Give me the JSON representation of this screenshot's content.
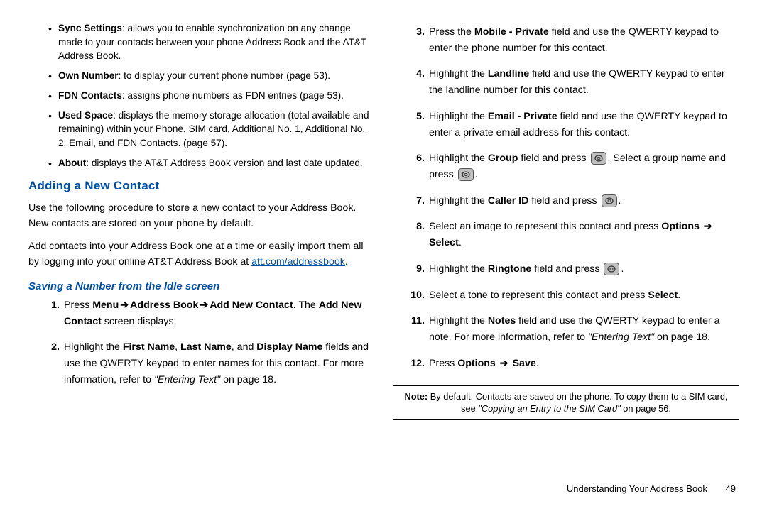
{
  "leftColumn": {
    "bullets": [
      {
        "term": "Sync Settings",
        "desc": ": allows you to enable synchronization on any change made to your contacts between your phone Address Book and the AT&T Address Book."
      },
      {
        "term": "Own Number",
        "desc": ": to display your current phone number (page 53)."
      },
      {
        "term": "FDN Contacts",
        "desc": ": assigns phone numbers as FDN entries (page 53)."
      },
      {
        "term": "Used Space",
        "desc": ": displays the memory storage allocation (total available and remaining) within your Phone, SIM card, Additional No. 1, Additional No. 2, Email, and FDN Contacts. (page 57)."
      },
      {
        "term": "About",
        "desc": ": displays the AT&T Address Book version and last date updated."
      }
    ],
    "heading1": "Adding a New Contact",
    "para1": "Use the following procedure to store a new contact to your Address Book. New contacts are stored on your phone by default.",
    "para2a": "Add contacts into your Address Book one at a time or easily import them all by logging into your online AT&T Address Book at ",
    "link": "att.com/addressbook",
    "para2b": ".",
    "heading2": "Saving a Number from the Idle screen",
    "step1": {
      "a": "Press ",
      "b1": "Menu",
      "b2": "Address Book",
      "b3": "Add New Contact",
      "c": ". The ",
      "d": "Add New Contact",
      "e": " screen displays."
    },
    "step2": {
      "a": "Highlight the ",
      "b1": "First Name",
      "c1": ", ",
      "b2": "Last Name",
      "c2": ", and ",
      "b3": "Display Name",
      "c3": " fields and use the QWERTY keypad to enter names for this contact. For more information, refer to ",
      "ref": "\"Entering Text\"",
      "c4": " on page 18."
    }
  },
  "rightColumn": {
    "steps": {
      "s3": {
        "a": "Press the ",
        "b": "Mobile - Private",
        "c": " field and use the QWERTY keypad to enter the phone number for this contact."
      },
      "s4": {
        "a": "Highlight the ",
        "b": "Landline",
        "c": " field and use the QWERTY keypad to enter the landline number for this contact."
      },
      "s5": {
        "a": "Highlight the ",
        "b": "Email - Private",
        "c": " field and use the QWERTY keypad to enter a private email address for this contact."
      },
      "s6": {
        "a": "Highlight the ",
        "b": "Group",
        "c": " field and press ",
        "d": ". Select a group name and press ",
        "e": "."
      },
      "s7": {
        "a": "Highlight the ",
        "b": "Caller ID",
        "c": " field and press ",
        "d": "."
      },
      "s8": {
        "a": "Select an image to represent this contact and press ",
        "b": "Options",
        "c": "Select",
        "d": "."
      },
      "s9": {
        "a": "Highlight the ",
        "b": "Ringtone",
        "c": " field and press ",
        "d": "."
      },
      "s10": {
        "a": "Select a tone to represent this contact and press ",
        "b": "Select",
        "c": "."
      },
      "s11": {
        "a": "Highlight the ",
        "b": "Notes",
        "c": " field and use the QWERTY keypad to enter a note. For more information, refer to ",
        "ref": "\"Entering Text\"",
        "d": " on page 18."
      },
      "s12": {
        "a": "Press ",
        "b": "Options",
        "c": "Save",
        "d": "."
      }
    },
    "note": {
      "a": "Note:",
      "b": " By default, Contacts are saved on the phone. To copy them to a SIM card, see ",
      "ref": "\"Copying an Entry to the SIM Card\"",
      "c": " on page 56."
    }
  },
  "footer": {
    "chapter": "Understanding Your Address Book",
    "page": "49"
  }
}
